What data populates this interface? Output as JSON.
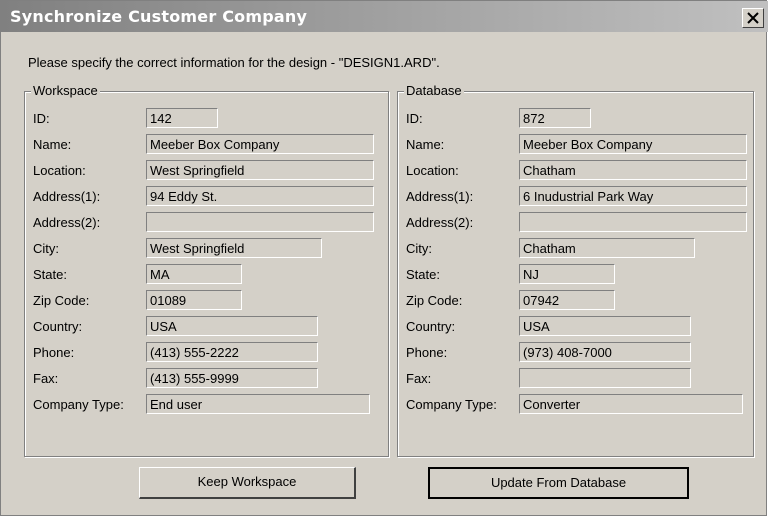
{
  "dialog": {
    "title": "Synchronize Customer Company",
    "prompt": "Please specify the correct information for the design - \"DESIGN1.ARD\"."
  },
  "labels": {
    "id": "ID:",
    "name": "Name:",
    "location": "Location:",
    "address1": "Address(1):",
    "address2": "Address(2):",
    "city": "City:",
    "state": "State:",
    "zip": "Zip Code:",
    "country": "Country:",
    "phone": "Phone:",
    "fax": "Fax:",
    "company_type": "Company Type:"
  },
  "workspace": {
    "legend": "Workspace",
    "id": "142",
    "name": "Meeber Box Company",
    "location": "West Springfield",
    "address1": "94 Eddy St.",
    "address2": "",
    "city": "West Springfield",
    "state": "MA",
    "zip": "01089",
    "country": "USA",
    "phone": "(413) 555-2222",
    "fax": "(413) 555-9999",
    "company_type": "End user"
  },
  "database": {
    "legend": "Database",
    "id": "872",
    "name": "Meeber Box Company",
    "location": "Chatham",
    "address1": "6 Inudustrial Park Way",
    "address2": "",
    "city": "Chatham",
    "state": "NJ",
    "zip": "07942",
    "country": "USA",
    "phone": "(973) 408-7000",
    "fax": "",
    "company_type": "Converter"
  },
  "buttons": {
    "keep": "Keep Workspace",
    "update": "Update From Database"
  },
  "icons": {
    "close": "close-icon"
  }
}
